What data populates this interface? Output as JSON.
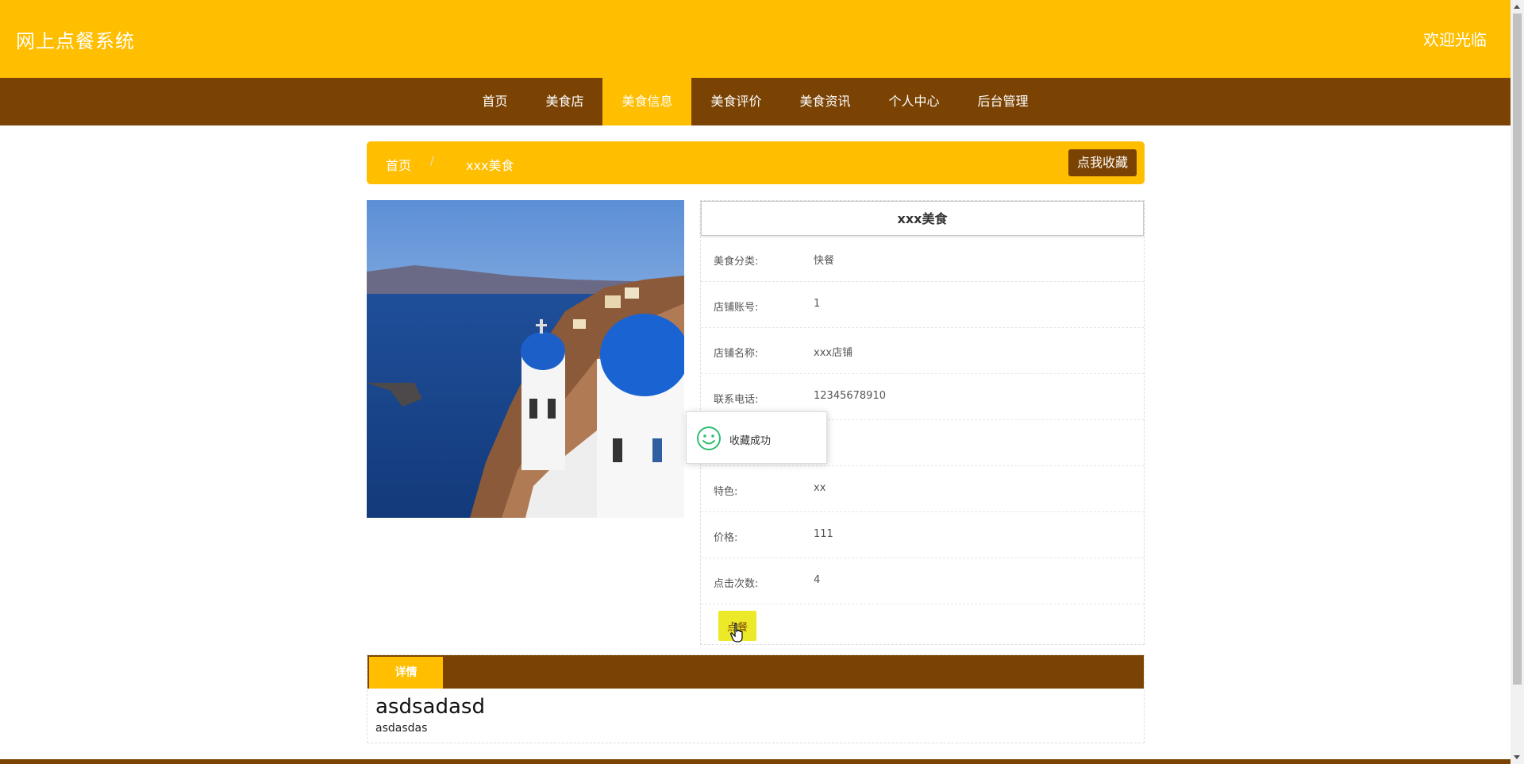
{
  "header": {
    "site_title": "网上点餐系统",
    "welcome": "欢迎光临"
  },
  "nav": {
    "items": [
      {
        "label": "首页",
        "active": false
      },
      {
        "label": "美食店",
        "active": false
      },
      {
        "label": "美食信息",
        "active": true
      },
      {
        "label": "美食评价",
        "active": false
      },
      {
        "label": "美食资讯",
        "active": false
      },
      {
        "label": "个人中心",
        "active": false
      },
      {
        "label": "后台管理",
        "active": false
      }
    ]
  },
  "breadcrumb": {
    "home": "首页",
    "separator": "/",
    "current": "xxx美食",
    "favorite_button": "点我收藏"
  },
  "info": {
    "title": "xxx美食",
    "rows": [
      {
        "label": "美食分类:",
        "value": "快餐"
      },
      {
        "label": "店铺账号:",
        "value": "1"
      },
      {
        "label": "店铺名称:",
        "value": "xxx店铺"
      },
      {
        "label": "联系电话:",
        "value": "12345678910"
      },
      {
        "label": "",
        "value": "xx"
      },
      {
        "label": "特色:",
        "value": "xx"
      },
      {
        "label": "价格:",
        "value": "111"
      },
      {
        "label": "点击次数:",
        "value": "4"
      }
    ],
    "order_button": "点餐"
  },
  "toast": {
    "message": "收藏成功"
  },
  "detail": {
    "tab_label": "详情",
    "heading": "asdsadasd",
    "body": "asdasdas"
  },
  "colors": {
    "brand_yellow": "#ffbe00",
    "brand_brown": "#7a4304",
    "order_button": "#ecea28",
    "toast_icon": "#2fbf71"
  }
}
